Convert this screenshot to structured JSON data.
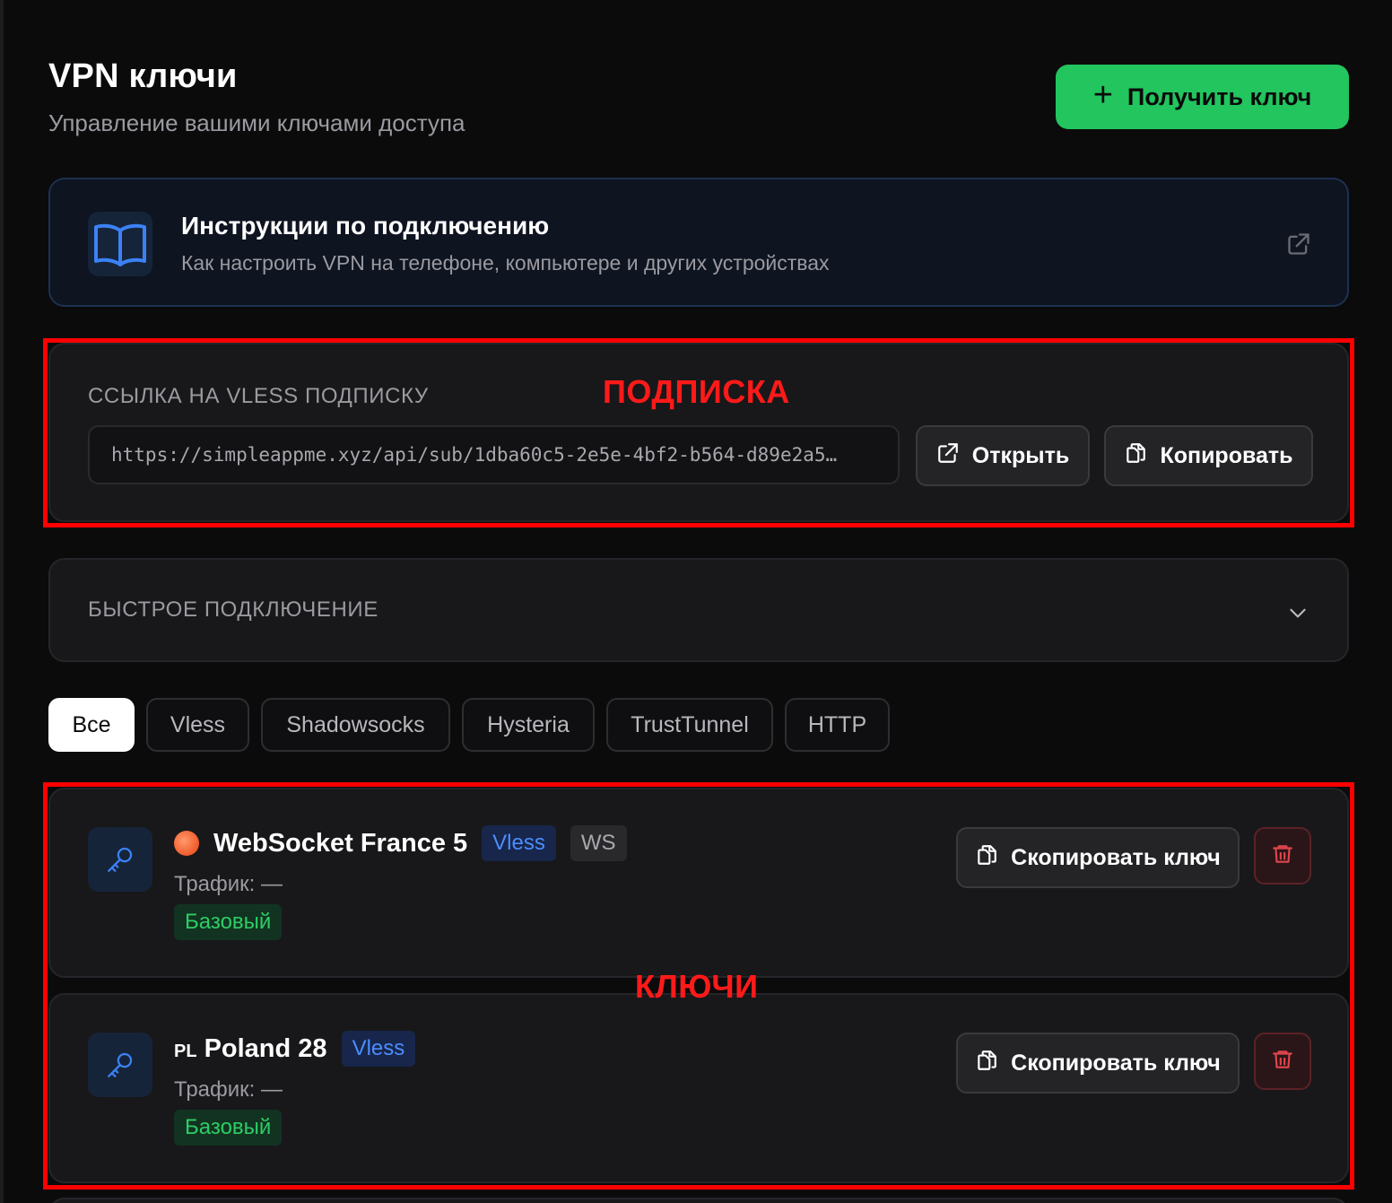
{
  "header": {
    "title": "VPN ключи",
    "subtitle": "Управление вашими ключами доступа",
    "get_key_label": "Получить ключ",
    "accent": "#22c55e"
  },
  "instructions": {
    "title": "Инструкции по подключению",
    "description": "Как настроить VPN на телефоне, компьютере и других устройствах",
    "icon": "book-icon"
  },
  "subscription": {
    "label": "ССЫЛКА НА VLESS ПОДПИСКУ",
    "url": "https://simpleappme.xyz/api/sub/1dba60c5-2e5e-4bf2-b564-d89e2a5…",
    "open_label": "Открыть",
    "copy_label": "Копировать"
  },
  "quick_connect": {
    "label": "БЫСТРОЕ ПОДКЛЮЧЕНИЕ"
  },
  "filters": [
    {
      "label": "Все",
      "active": true
    },
    {
      "label": "Vless"
    },
    {
      "label": "Shadowsocks"
    },
    {
      "label": "Hysteria"
    },
    {
      "label": "TrustTunnel"
    },
    {
      "label": "HTTP"
    }
  ],
  "keys": [
    {
      "flag": "",
      "name": "WebSocket France 5",
      "protocol": "Vless",
      "transport": "WS",
      "traffic": "Трафик: —",
      "plan": "Базовый",
      "copy_label": "Скопировать ключ"
    },
    {
      "flag": "PL",
      "name": "Poland 28",
      "protocol": "Vless",
      "traffic": "Трафик: —",
      "plan": "Базовый",
      "copy_label": "Скопировать ключ"
    }
  ],
  "annotations": {
    "subscription": "ПОДПИСКА",
    "keys": "КЛЮЧИ",
    "color": "#ff0000"
  }
}
